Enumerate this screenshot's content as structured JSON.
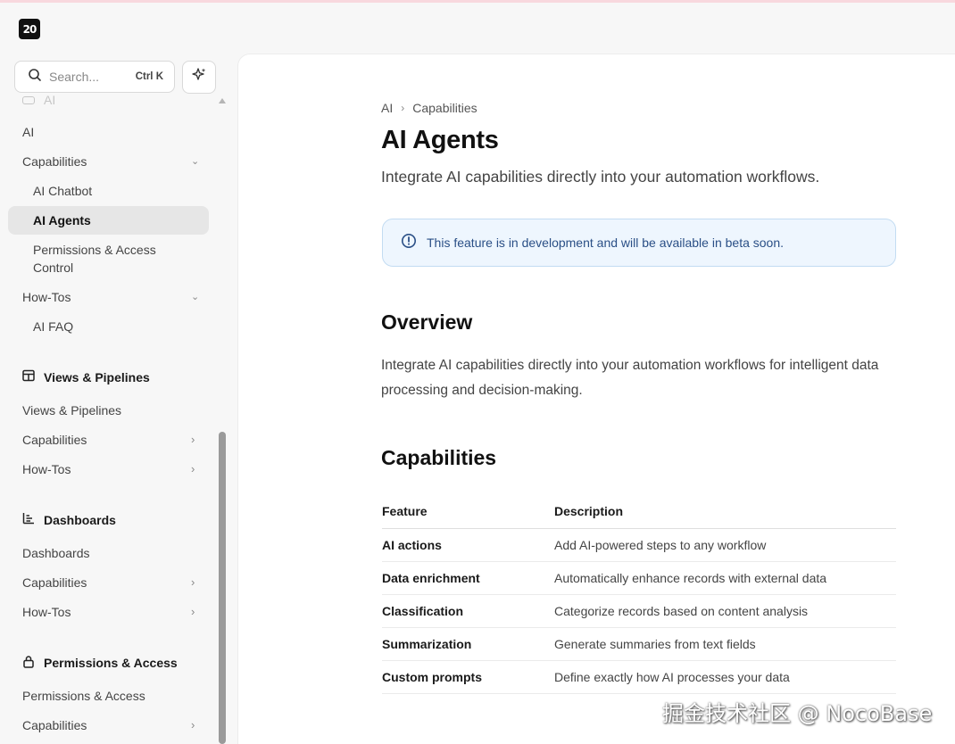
{
  "app": {
    "logo_text": "20"
  },
  "search": {
    "placeholder": "Search...",
    "shortcut": "Ctrl K"
  },
  "sidebar": {
    "faded_section": "AI",
    "ai_items": [
      {
        "label": "AI"
      },
      {
        "label": "Capabilities",
        "chevron": "chevron-down-icon"
      },
      {
        "label": "AI Chatbot"
      },
      {
        "label": "AI Agents",
        "active": true
      },
      {
        "label": "Permissions & Access Control"
      },
      {
        "label": "How-Tos",
        "chevron": "chevron-down-icon"
      },
      {
        "label": "AI FAQ"
      }
    ],
    "views_section": {
      "title": "Views & Pipelines",
      "items": [
        {
          "label": "Views & Pipelines"
        },
        {
          "label": "Capabilities"
        },
        {
          "label": "How-Tos"
        }
      ]
    },
    "dashboards_section": {
      "title": "Dashboards",
      "items": [
        {
          "label": "Dashboards"
        },
        {
          "label": "Capabilities"
        },
        {
          "label": "How-Tos"
        }
      ]
    },
    "permissions_section": {
      "title": "Permissions & Access",
      "items": [
        {
          "label": "Permissions & Access"
        },
        {
          "label": "Capabilities"
        }
      ]
    }
  },
  "main": {
    "breadcrumb": [
      "AI",
      "Capabilities"
    ],
    "title": "AI Agents",
    "lead": "Integrate AI capabilities directly into your automation workflows.",
    "callout": "This feature is in development and will be available in beta soon.",
    "overview_heading": "Overview",
    "overview_text": "Integrate AI capabilities directly into your automation workflows for intelligent data processing and decision-making.",
    "capabilities_heading": "Capabilities",
    "table": {
      "headers": [
        "Feature",
        "Description"
      ],
      "rows": [
        [
          "AI actions",
          "Add AI-powered steps to any workflow"
        ],
        [
          "Data enrichment",
          "Automatically enhance records with external data"
        ],
        [
          "Classification",
          "Categorize records based on content analysis"
        ],
        [
          "Summarization",
          "Generate summaries from text fields"
        ],
        [
          "Custom prompts",
          "Define exactly how AI processes your data"
        ]
      ]
    }
  },
  "watermark": "掘金技术社区 @ NocoBase"
}
